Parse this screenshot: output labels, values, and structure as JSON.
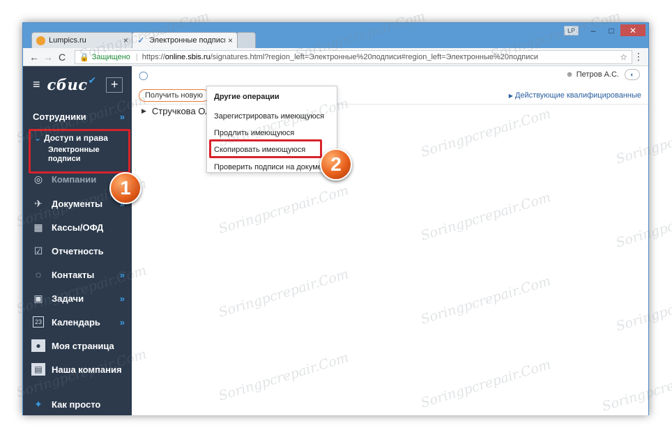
{
  "browser": {
    "tabs": [
      {
        "title": "Lumpics.ru",
        "close": "×"
      },
      {
        "title": "Электронные подписи/С",
        "close": "×"
      }
    ],
    "profile": "LP",
    "win_min": "–",
    "win_max": "□",
    "win_close": "✕",
    "back": "←",
    "forward": "→",
    "reload": "C",
    "secure_label": "Защищено",
    "url_prefix": "https://",
    "url_host": "online.sbis.ru",
    "url_path": "/signatures.html?region_left=Электронные%20подписи#region_left=Электронные%20подписи",
    "star": "☆",
    "menu": "⋮"
  },
  "sidebar": {
    "hamburger": "≡",
    "logo": "сбис",
    "plus": "+",
    "section_employees": "Сотрудники",
    "access_rights": "Доступ и права",
    "electronic_signatures": "Электронные подписи",
    "items": [
      {
        "label": "Компании",
        "icon": "companies-icon"
      },
      {
        "label": "Документы",
        "icon": "paper-plane-icon"
      },
      {
        "label": "Кассы/ОФД",
        "icon": "cash-register-icon"
      },
      {
        "label": "Отчетность",
        "icon": "report-check-icon"
      },
      {
        "label": "Контакты",
        "icon": "chat-icon"
      },
      {
        "label": "Задачи",
        "icon": "task-bag-icon"
      },
      {
        "label": "Календарь",
        "icon": "calendar-icon"
      },
      {
        "label": "Моя страница",
        "icon": "user-avatar-icon"
      },
      {
        "label": "Наша компания",
        "icon": "building-icon"
      },
      {
        "label": "Как просто",
        "icon": "bird-icon"
      }
    ],
    "calendar_day": "23",
    "arrow": "»"
  },
  "content": {
    "user_name": "Петров А.С.",
    "get_new": "Получить новую",
    "right_link": "Действующие квалифицированные",
    "row_name": "Стручкова Оль"
  },
  "dropdown": {
    "header": "Другие операции",
    "items": [
      "Зарегистрировать имеющуюся",
      "Продлить имеющуюся",
      "Скопировать имеющуюся",
      "Проверить подписи на документе"
    ]
  },
  "badges": {
    "one": "1",
    "two": "2"
  },
  "watermark": "Soringpcrepair.Com",
  "colors": {
    "sidebar_bg": "#2c3a4c",
    "accent_blue": "#3b9be0",
    "highlight_red": "#d8232a",
    "badge_orange": "#e8601c"
  }
}
